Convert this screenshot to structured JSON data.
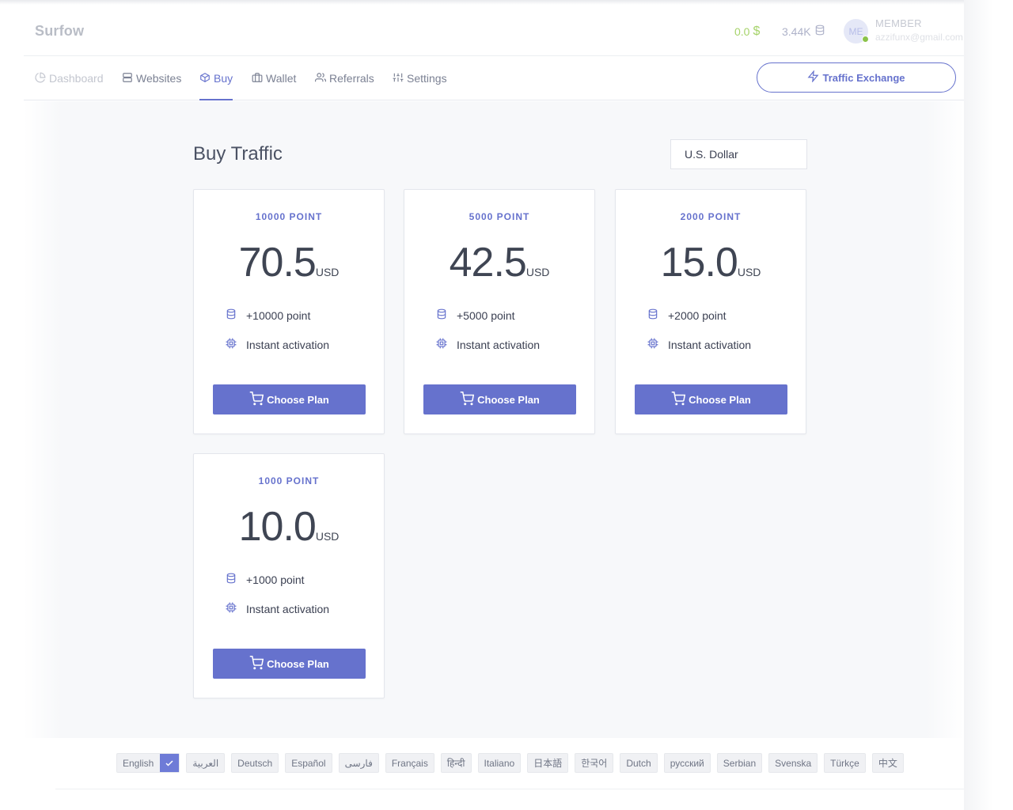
{
  "header": {
    "brand": "Surfow",
    "balance": "0.0",
    "balance_symbol": "$",
    "points": "3.44K",
    "avatar_initials": "ME",
    "member_role": "MEMBER",
    "member_email": "azzifunx@gmail.com"
  },
  "nav": {
    "items": [
      {
        "label": "Dashboard",
        "icon": "pie-chart-icon",
        "state": "disabled"
      },
      {
        "label": "Websites",
        "icon": "server-icon",
        "state": "normal"
      },
      {
        "label": "Buy",
        "icon": "box-icon",
        "state": "active"
      },
      {
        "label": "Wallet",
        "icon": "briefcase-icon",
        "state": "normal"
      },
      {
        "label": "Referrals",
        "icon": "users-icon",
        "state": "normal"
      },
      {
        "label": "Settings",
        "icon": "sliders-icon",
        "state": "normal"
      }
    ],
    "traffic_button": "Traffic Exchange"
  },
  "main": {
    "title": "Buy Traffic",
    "currency": "U.S. Dollar",
    "plans": [
      {
        "name": "10000 POINT",
        "price": "70.5",
        "unit": "USD",
        "feature_points": "+10000 point",
        "feature_activation": "Instant activation",
        "button": "Choose Plan"
      },
      {
        "name": "5000 POINT",
        "price": "42.5",
        "unit": "USD",
        "feature_points": "+5000 point",
        "feature_activation": "Instant activation",
        "button": "Choose Plan"
      },
      {
        "name": "2000 POINT",
        "price": "15.0",
        "unit": "USD",
        "feature_points": "+2000 point",
        "feature_activation": "Instant activation",
        "button": "Choose Plan"
      },
      {
        "name": "1000 POINT",
        "price": "10.0",
        "unit": "USD",
        "feature_points": "+1000 point",
        "feature_activation": "Instant activation",
        "button": "Choose Plan"
      }
    ]
  },
  "footer": {
    "languages": [
      "English",
      "العربية",
      "Deutsch",
      "Español",
      "فارسی",
      "Français",
      "हिन्दी",
      "Italiano",
      "日本語",
      "한국어",
      "Dutch",
      "русский",
      "Serbian",
      "Svenska",
      "Türkçe",
      "中文"
    ],
    "selected_language": "English"
  },
  "colors": {
    "accent": "#6672cd",
    "balance_green": "#a6d36a",
    "online_dot": "#8bc34a"
  }
}
